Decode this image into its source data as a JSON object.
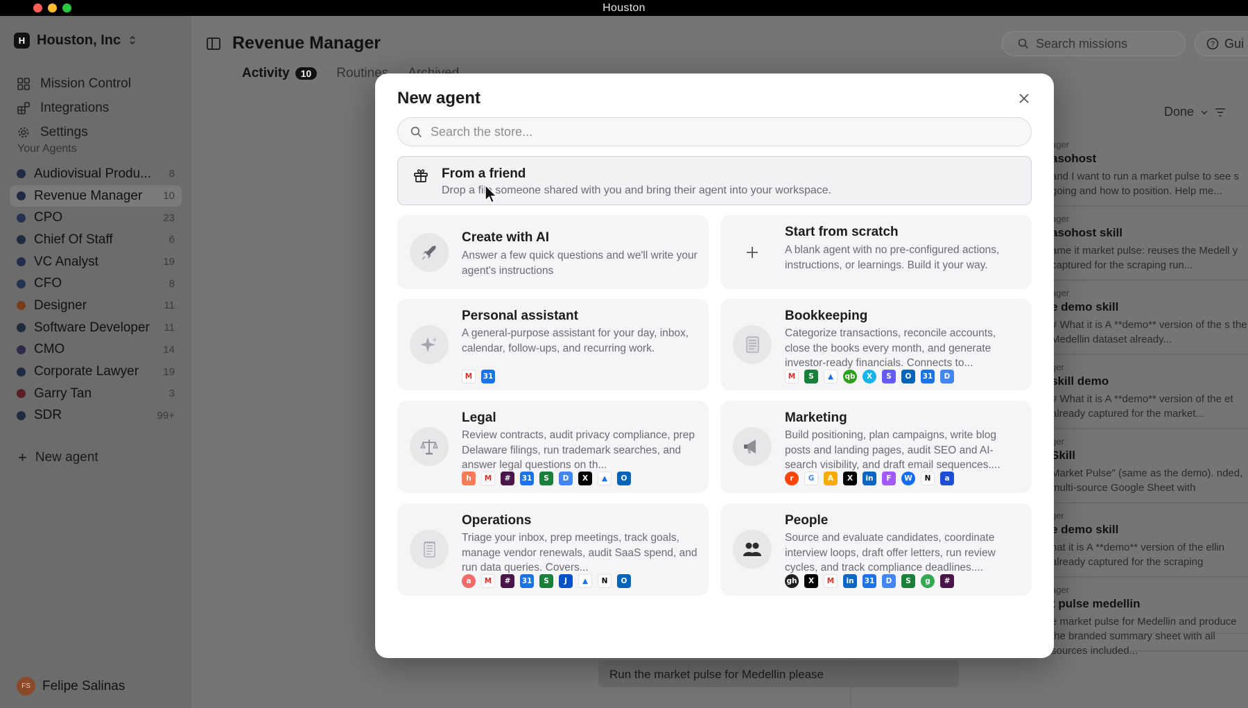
{
  "window": {
    "title": "Houston"
  },
  "sidebar": {
    "workspace": {
      "initial": "H",
      "name": "Houston, Inc"
    },
    "nav": [
      {
        "label": "Mission Control",
        "icon": "grid-icon"
      },
      {
        "label": "Integrations",
        "icon": "integrations-icon"
      },
      {
        "label": "Settings",
        "icon": "gear-icon"
      }
    ],
    "section_label": "Your Agents",
    "agents": [
      {
        "name": "Audiovisual Produ...",
        "count": "8",
        "color": "#1f2a44"
      },
      {
        "name": "Revenue Manager",
        "count": "10",
        "color": "#1f2a44",
        "active": true
      },
      {
        "name": "CPO",
        "count": "23",
        "color": "#243150"
      },
      {
        "name": "Chief Of Staff",
        "count": "6",
        "color": "#1e2b3e"
      },
      {
        "name": "VC Analyst",
        "count": "19",
        "color": "#232c4a"
      },
      {
        "name": "CFO",
        "count": "8",
        "color": "#243150"
      },
      {
        "name": "Designer",
        "count": "11",
        "color": "#7a3d1c"
      },
      {
        "name": "Software Developer",
        "count": "11",
        "color": "#1e2b3e"
      },
      {
        "name": "CMO",
        "count": "14",
        "color": "#2d2a4a"
      },
      {
        "name": "Corporate Lawyer",
        "count": "19",
        "color": "#1f2a44"
      },
      {
        "name": "Garry Tan",
        "count": "3",
        "color": "#5a1e26"
      },
      {
        "name": "SDR",
        "count": "99+",
        "color": "#1e2b3e"
      }
    ],
    "new_agent_label": "New agent",
    "user": {
      "initials": "FS",
      "name": "Felipe Salinas"
    }
  },
  "main": {
    "title": "Revenue Manager",
    "search_placeholder": "Search missions",
    "guide_label": "Gui",
    "tabs": [
      {
        "label": "Activity",
        "badge": "10",
        "active": true
      },
      {
        "label": "Routines"
      },
      {
        "label": "Archived"
      }
    ],
    "filter_label": "Done",
    "feed": [
      {
        "meta": "ager",
        "title": "asohost",
        "body": "and I want to run a market pulse to see s going and how to position. Help me..."
      },
      {
        "meta": "ager",
        "title": "asohost skill",
        "body": "ame it market pulse: reuses the Medell y captured for the scraping run..."
      },
      {
        "meta": "ager",
        "title": "e demo skill",
        "body": "# What it is A **demo** version of the s the Medellin dataset already..."
      },
      {
        "meta": "ger",
        "title": "skill demo",
        "body": "# What it is A **demo** version of the et already captured for the market..."
      },
      {
        "meta": "ger",
        "title": "Skill",
        "body": "Market Pulse\" (same as the demo). nded, multi-source Google Sheet with"
      },
      {
        "meta": "ger",
        "title": "e demo skill",
        "body": "hat it is A **demo** version of the ellin already captured for the scraping"
      },
      {
        "meta": "ager",
        "title": "t pulse medellin",
        "body": "e market pulse for Medellin and produce the branded summary sheet with all sources included..."
      }
    ],
    "chat_message": "Run the market pulse for Medellin please"
  },
  "modal": {
    "title": "New agent",
    "search_placeholder": "Search the store...",
    "friend": {
      "title": "From a friend",
      "desc": "Drop a file someone shared with you and bring their agent into your workspace."
    },
    "cards": [
      {
        "title": "Create with AI",
        "desc": "Answer a few quick questions and we'll write your agent's instructions",
        "icon": "rocket-icon",
        "chips": []
      },
      {
        "title": "Start from scratch",
        "desc": "A blank agent with no pre-configured actions, instructions, or learnings. Build it your way.",
        "icon": "plus-icon",
        "chips": []
      },
      {
        "title": "Personal assistant",
        "desc": "A general-purpose assistant for your day, inbox, calendar, follow-ups, and recurring work.",
        "icon": "sparkle-icon",
        "chips": [
          {
            "t": "M",
            "bg": "#ffffff",
            "fg": "#d93025",
            "light": true
          },
          {
            "t": "31",
            "bg": "#1a73e8",
            "fg": "#fff"
          }
        ]
      },
      {
        "title": "Bookkeeping",
        "desc": "Categorize transactions, reconcile accounts, close the books every month, and generate investor-ready financials. Connects to...",
        "icon": "ledger-icon",
        "chips": [
          {
            "t": "M",
            "bg": "#ffffff",
            "fg": "#d93025",
            "light": true
          },
          {
            "t": "S",
            "bg": "#188038",
            "fg": "#fff"
          },
          {
            "t": "▲",
            "bg": "#ffffff",
            "fg": "#1a73e8",
            "light": true
          },
          {
            "t": "qb",
            "bg": "#2ca01c",
            "fg": "#fff",
            "round": true
          },
          {
            "t": "X",
            "bg": "#13b5ea",
            "fg": "#fff",
            "round": true
          },
          {
            "t": "S",
            "bg": "#635bff",
            "fg": "#fff"
          },
          {
            "t": "O",
            "bg": "#0364b8",
            "fg": "#fff"
          },
          {
            "t": "31",
            "bg": "#1a73e8",
            "fg": "#fff"
          },
          {
            "t": "D",
            "bg": "#4285f4",
            "fg": "#fff"
          }
        ]
      },
      {
        "title": "Legal",
        "desc": "Review contracts, audit privacy compliance, prep Delaware filings, run trademark searches, and answer legal questions on th...",
        "icon": "scales-icon",
        "chips": [
          {
            "t": "h",
            "bg": "#ff7a59",
            "fg": "#fff"
          },
          {
            "t": "M",
            "bg": "#ffffff",
            "fg": "#d93025",
            "light": true
          },
          {
            "t": "#",
            "bg": "#4a154b",
            "fg": "#fff"
          },
          {
            "t": "31",
            "bg": "#1a73e8",
            "fg": "#fff"
          },
          {
            "t": "S",
            "bg": "#188038",
            "fg": "#fff"
          },
          {
            "t": "D",
            "bg": "#4285f4",
            "fg": "#fff"
          },
          {
            "t": "X",
            "bg": "#000000",
            "fg": "#fff"
          },
          {
            "t": "▲",
            "bg": "#ffffff",
            "fg": "#1a73e8",
            "light": true
          },
          {
            "t": "O",
            "bg": "#0364b8",
            "fg": "#fff"
          }
        ]
      },
      {
        "title": "Marketing",
        "desc": "Build positioning, plan campaigns, write blog posts and landing pages, audit SEO and AI-search visibility, and draft email sequences....",
        "icon": "megaphone-icon",
        "chips": [
          {
            "t": "r",
            "bg": "#ff4500",
            "fg": "#fff",
            "round": true
          },
          {
            "t": "G",
            "bg": "#ffffff",
            "fg": "#4285f4",
            "light": true
          },
          {
            "t": "A",
            "bg": "#f9ab00",
            "fg": "#fff"
          },
          {
            "t": "X",
            "bg": "#000000",
            "fg": "#fff"
          },
          {
            "t": "in",
            "bg": "#0a66c2",
            "fg": "#fff"
          },
          {
            "t": "F",
            "bg": "#a259ff",
            "fg": "#fff"
          },
          {
            "t": "W",
            "bg": "#146ef5",
            "fg": "#fff",
            "round": true
          },
          {
            "t": "N",
            "bg": "#ffffff",
            "fg": "#000",
            "light": true
          },
          {
            "t": "a",
            "bg": "#1d4ed8",
            "fg": "#fff"
          }
        ]
      },
      {
        "title": "Operations",
        "desc": "Triage your inbox, prep meetings, track goals, manage vendor renewals, audit SaaS spend, and run data queries. Covers...",
        "icon": "notepad-icon",
        "chips": [
          {
            "t": "a",
            "bg": "#f06a6a",
            "fg": "#fff",
            "round": true
          },
          {
            "t": "M",
            "bg": "#ffffff",
            "fg": "#d93025",
            "light": true
          },
          {
            "t": "#",
            "bg": "#4a154b",
            "fg": "#fff"
          },
          {
            "t": "31",
            "bg": "#1a73e8",
            "fg": "#fff"
          },
          {
            "t": "S",
            "bg": "#188038",
            "fg": "#fff"
          },
          {
            "t": "J",
            "bg": "#0052cc",
            "fg": "#fff"
          },
          {
            "t": "▲",
            "bg": "#ffffff",
            "fg": "#1a73e8",
            "light": true
          },
          {
            "t": "N",
            "bg": "#ffffff",
            "fg": "#000",
            "light": true
          },
          {
            "t": "O",
            "bg": "#0364b8",
            "fg": "#fff"
          }
        ]
      },
      {
        "title": "People",
        "desc": "Source and evaluate candidates, coordinate interview loops, draft offer letters, run review cycles, and track compliance deadlines....",
        "icon": "people-icon",
        "chips": [
          {
            "t": "gh",
            "bg": "#1f1f1f",
            "fg": "#fff",
            "round": true
          },
          {
            "t": "X",
            "bg": "#000000",
            "fg": "#fff"
          },
          {
            "t": "M",
            "bg": "#ffffff",
            "fg": "#d93025",
            "light": true
          },
          {
            "t": "in",
            "bg": "#0a66c2",
            "fg": "#fff"
          },
          {
            "t": "31",
            "bg": "#1a73e8",
            "fg": "#fff"
          },
          {
            "t": "D",
            "bg": "#4285f4",
            "fg": "#fff"
          },
          {
            "t": "S",
            "bg": "#188038",
            "fg": "#fff"
          },
          {
            "t": "g",
            "bg": "#34a853",
            "fg": "#fff",
            "round": true
          },
          {
            "t": "#",
            "bg": "#4a154b",
            "fg": "#fff"
          }
        ]
      }
    ]
  }
}
